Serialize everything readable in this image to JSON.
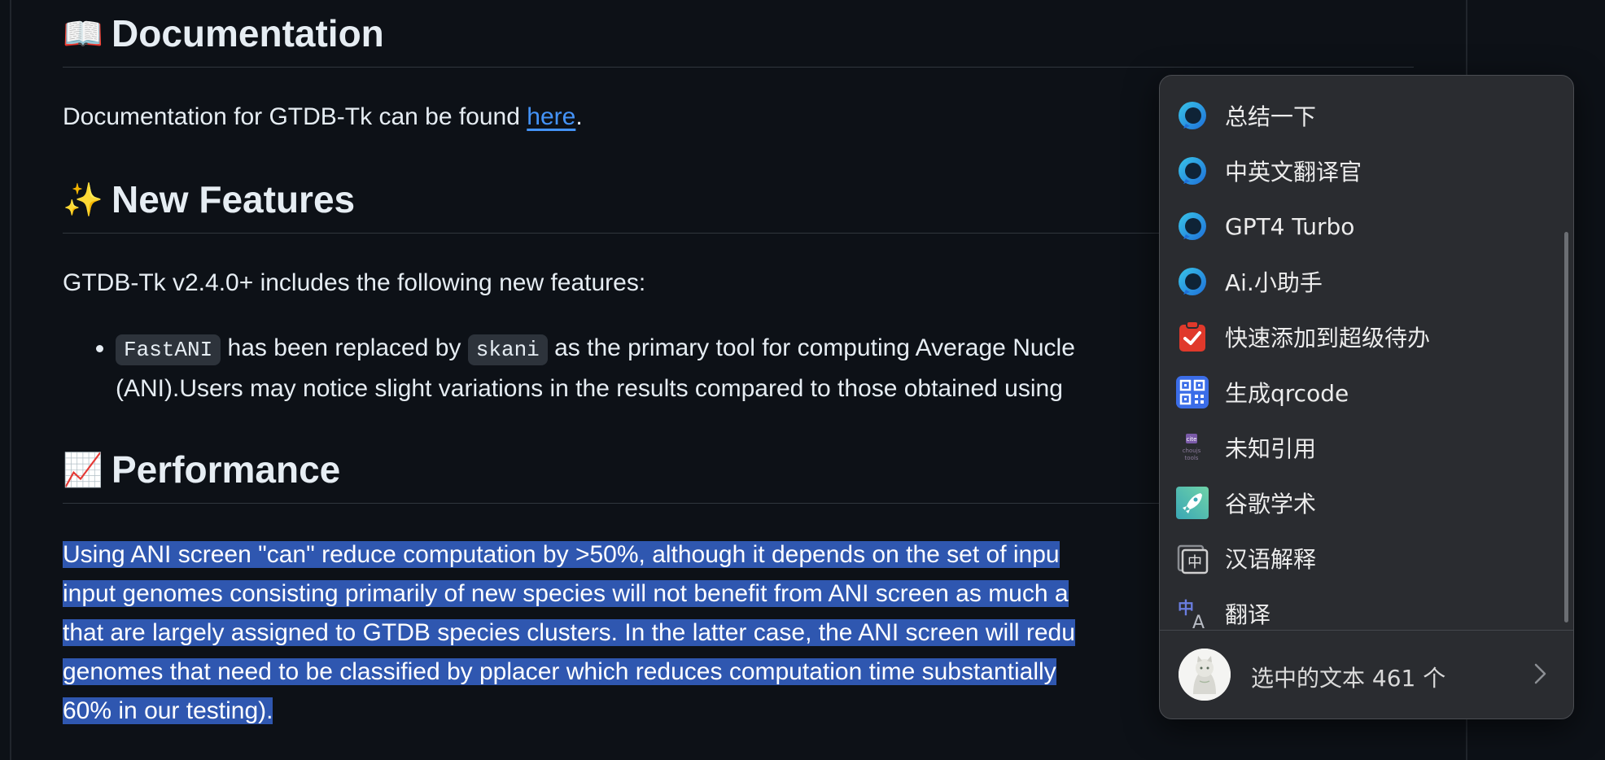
{
  "documentation": {
    "emoji": "📖",
    "heading": "Documentation",
    "text_before": "Documentation for GTDB-Tk can be found ",
    "link": "here",
    "text_after": "."
  },
  "new_features": {
    "emoji": "✨",
    "heading": "New Features",
    "intro": "GTDB-Tk v2.4.0+ includes the following new features:",
    "bullet": {
      "code1": "FastANI",
      "text1": " has been replaced by ",
      "code2": "skani",
      "text2": " as the primary tool for computing Average Nucle",
      "line2": "(ANI).Users may notice slight variations in the results compared to those obtained using"
    }
  },
  "performance": {
    "emoji": "📈",
    "heading": "Performance",
    "lines": [
      "Using ANI screen \"can\" reduce computation by >50%, although it depends on the set of inpu",
      "input genomes consisting primarily of new species will not benefit from ANI screen as much a",
      "that are largely assigned to GTDB species clusters. In the latter case, the ANI screen will redu",
      "genomes that need to be classified by pplacer which reduces computation time substantially",
      "60% in our testing)."
    ]
  },
  "popup": {
    "items": [
      {
        "label": "总结一下",
        "icon": "chat-bubble-icon"
      },
      {
        "label": "中英文翻译官",
        "icon": "chat-bubble-icon"
      },
      {
        "label": "GPT4 Turbo",
        "icon": "chat-bubble-icon"
      },
      {
        "label": "Ai.小助手",
        "icon": "chat-bubble-icon"
      },
      {
        "label": "快速添加到超级待办",
        "icon": "clipboard-check-icon"
      },
      {
        "label": "生成qrcode",
        "icon": "qrcode-icon"
      },
      {
        "label": "未知引用",
        "icon": "cite-tools-icon",
        "icon_text": "choujs tools"
      },
      {
        "label": "谷歌学术",
        "icon": "rocket-icon"
      },
      {
        "label": "汉语解释",
        "icon": "dictionary-icon",
        "icon_text": "中"
      },
      {
        "label": "翻译",
        "icon": "translate-icon",
        "icon_text_zh": "中",
        "icon_text_en": "A"
      }
    ],
    "footer_text": "选中的文本 461 个"
  },
  "colors": {
    "background": "#0d1117",
    "selection": "#2f57b0",
    "link": "#4493f8",
    "popup_bg": "#2a2c30"
  }
}
